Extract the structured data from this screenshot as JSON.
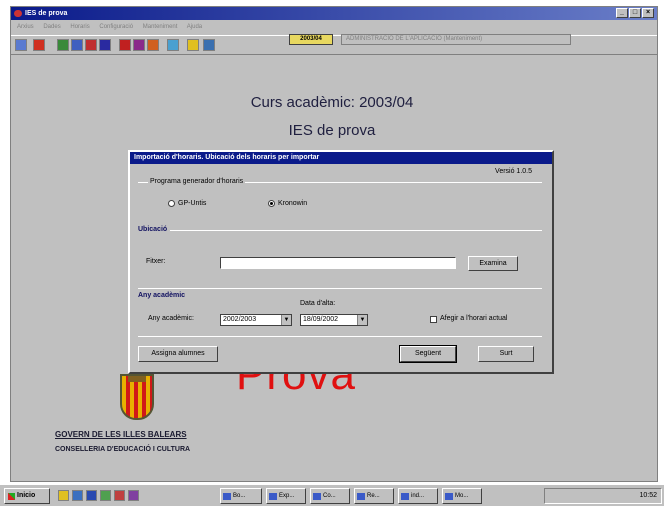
{
  "window": {
    "title": "IES de prova",
    "controls": [
      "_",
      "□",
      "×"
    ]
  },
  "menu": [
    "Arxius",
    "Dades",
    "Horaris",
    "Configuració",
    "Manteniment",
    "Ajuda"
  ],
  "toolbar": {
    "year": "2003/04",
    "admin": "ADMINISTRACIÓ DE L'APLICACIÓ (Manteniment)"
  },
  "main": {
    "title": "Curs acadèmic: 2003/04",
    "subtitle": "IES de prova",
    "watermark": "Prova"
  },
  "logo": {
    "line1": "GOVERN DE LES ILLES BALEARS",
    "line2": "CONSELLERIA D'EDUCACIÓ I CULTURA"
  },
  "dialog": {
    "title": "Importació d'horaris. Ubicació dels horaris per importar",
    "version": "Versió 1.0.5",
    "program_group": "Programa generador d'horaris",
    "options": [
      "GP-Untis",
      "Kronowin"
    ],
    "selected": "Kronowin",
    "location_title": "Ubicació",
    "file_label": "Fitxer:",
    "file_value": "",
    "browse_button": "Examina",
    "year_title": "Any acadèmic",
    "year_label": "Any acadèmic:",
    "year_value": "2002/2003",
    "date_label": "Data d'alta:",
    "date_value": "18/09/2002",
    "append_label": "Afegir a l'horari actual",
    "assign_button": "Assigna alumnes",
    "next_button": "Següent",
    "exit_button": "Surt"
  },
  "taskbar": {
    "start": "Inicio",
    "tasks": [
      "Bo...",
      "Exp...",
      "Co...",
      "Re...",
      "ind...",
      "Mo..."
    ],
    "clock": "10:52"
  },
  "colors": {
    "title_bar": "#0a1a8a",
    "watermark": "#e01010",
    "year_box": "#e8d860"
  }
}
